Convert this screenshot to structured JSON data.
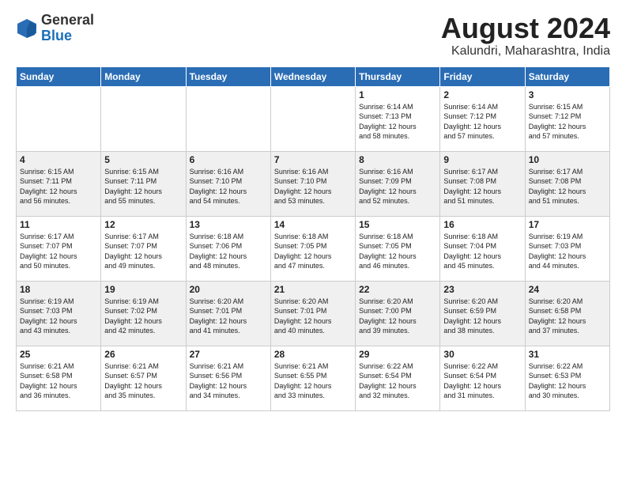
{
  "header": {
    "logo_general": "General",
    "logo_blue": "Blue",
    "month_year": "August 2024",
    "location": "Kalundri, Maharashtra, India"
  },
  "weekdays": [
    "Sunday",
    "Monday",
    "Tuesday",
    "Wednesday",
    "Thursday",
    "Friday",
    "Saturday"
  ],
  "weeks": [
    [
      {
        "day": "",
        "info": ""
      },
      {
        "day": "",
        "info": ""
      },
      {
        "day": "",
        "info": ""
      },
      {
        "day": "",
        "info": ""
      },
      {
        "day": "1",
        "info": "Sunrise: 6:14 AM\nSunset: 7:13 PM\nDaylight: 12 hours\nand 58 minutes."
      },
      {
        "day": "2",
        "info": "Sunrise: 6:14 AM\nSunset: 7:12 PM\nDaylight: 12 hours\nand 57 minutes."
      },
      {
        "day": "3",
        "info": "Sunrise: 6:15 AM\nSunset: 7:12 PM\nDaylight: 12 hours\nand 57 minutes."
      }
    ],
    [
      {
        "day": "4",
        "info": "Sunrise: 6:15 AM\nSunset: 7:11 PM\nDaylight: 12 hours\nand 56 minutes."
      },
      {
        "day": "5",
        "info": "Sunrise: 6:15 AM\nSunset: 7:11 PM\nDaylight: 12 hours\nand 55 minutes."
      },
      {
        "day": "6",
        "info": "Sunrise: 6:16 AM\nSunset: 7:10 PM\nDaylight: 12 hours\nand 54 minutes."
      },
      {
        "day": "7",
        "info": "Sunrise: 6:16 AM\nSunset: 7:10 PM\nDaylight: 12 hours\nand 53 minutes."
      },
      {
        "day": "8",
        "info": "Sunrise: 6:16 AM\nSunset: 7:09 PM\nDaylight: 12 hours\nand 52 minutes."
      },
      {
        "day": "9",
        "info": "Sunrise: 6:17 AM\nSunset: 7:08 PM\nDaylight: 12 hours\nand 51 minutes."
      },
      {
        "day": "10",
        "info": "Sunrise: 6:17 AM\nSunset: 7:08 PM\nDaylight: 12 hours\nand 51 minutes."
      }
    ],
    [
      {
        "day": "11",
        "info": "Sunrise: 6:17 AM\nSunset: 7:07 PM\nDaylight: 12 hours\nand 50 minutes."
      },
      {
        "day": "12",
        "info": "Sunrise: 6:17 AM\nSunset: 7:07 PM\nDaylight: 12 hours\nand 49 minutes."
      },
      {
        "day": "13",
        "info": "Sunrise: 6:18 AM\nSunset: 7:06 PM\nDaylight: 12 hours\nand 48 minutes."
      },
      {
        "day": "14",
        "info": "Sunrise: 6:18 AM\nSunset: 7:05 PM\nDaylight: 12 hours\nand 47 minutes."
      },
      {
        "day": "15",
        "info": "Sunrise: 6:18 AM\nSunset: 7:05 PM\nDaylight: 12 hours\nand 46 minutes."
      },
      {
        "day": "16",
        "info": "Sunrise: 6:18 AM\nSunset: 7:04 PM\nDaylight: 12 hours\nand 45 minutes."
      },
      {
        "day": "17",
        "info": "Sunrise: 6:19 AM\nSunset: 7:03 PM\nDaylight: 12 hours\nand 44 minutes."
      }
    ],
    [
      {
        "day": "18",
        "info": "Sunrise: 6:19 AM\nSunset: 7:03 PM\nDaylight: 12 hours\nand 43 minutes."
      },
      {
        "day": "19",
        "info": "Sunrise: 6:19 AM\nSunset: 7:02 PM\nDaylight: 12 hours\nand 42 minutes."
      },
      {
        "day": "20",
        "info": "Sunrise: 6:20 AM\nSunset: 7:01 PM\nDaylight: 12 hours\nand 41 minutes."
      },
      {
        "day": "21",
        "info": "Sunrise: 6:20 AM\nSunset: 7:01 PM\nDaylight: 12 hours\nand 40 minutes."
      },
      {
        "day": "22",
        "info": "Sunrise: 6:20 AM\nSunset: 7:00 PM\nDaylight: 12 hours\nand 39 minutes."
      },
      {
        "day": "23",
        "info": "Sunrise: 6:20 AM\nSunset: 6:59 PM\nDaylight: 12 hours\nand 38 minutes."
      },
      {
        "day": "24",
        "info": "Sunrise: 6:20 AM\nSunset: 6:58 PM\nDaylight: 12 hours\nand 37 minutes."
      }
    ],
    [
      {
        "day": "25",
        "info": "Sunrise: 6:21 AM\nSunset: 6:58 PM\nDaylight: 12 hours\nand 36 minutes."
      },
      {
        "day": "26",
        "info": "Sunrise: 6:21 AM\nSunset: 6:57 PM\nDaylight: 12 hours\nand 35 minutes."
      },
      {
        "day": "27",
        "info": "Sunrise: 6:21 AM\nSunset: 6:56 PM\nDaylight: 12 hours\nand 34 minutes."
      },
      {
        "day": "28",
        "info": "Sunrise: 6:21 AM\nSunset: 6:55 PM\nDaylight: 12 hours\nand 33 minutes."
      },
      {
        "day": "29",
        "info": "Sunrise: 6:22 AM\nSunset: 6:54 PM\nDaylight: 12 hours\nand 32 minutes."
      },
      {
        "day": "30",
        "info": "Sunrise: 6:22 AM\nSunset: 6:54 PM\nDaylight: 12 hours\nand 31 minutes."
      },
      {
        "day": "31",
        "info": "Sunrise: 6:22 AM\nSunset: 6:53 PM\nDaylight: 12 hours\nand 30 minutes."
      }
    ]
  ]
}
